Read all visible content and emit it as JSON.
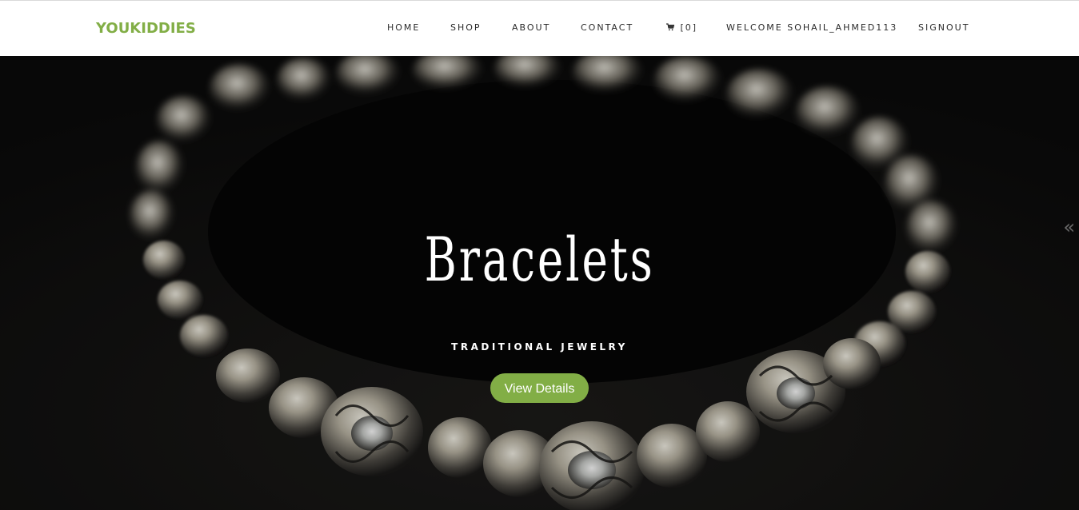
{
  "brand": {
    "name": "YOUKIDDIES",
    "color": "#82ae46"
  },
  "nav": {
    "home": "HOME",
    "shop": "SHOP",
    "about": "ABOUT",
    "contact": "CONTACT",
    "cart_icon": "cart-icon",
    "cart_count": "[0]",
    "welcome": "WELCOME SOHAIL_AHMED113",
    "signout": "SIGNOUT"
  },
  "hero": {
    "title": "Bracelets",
    "subtitle": "TRADITIONAL JEWELRY",
    "button_label": "View Details",
    "button_color": "#82ae46",
    "prev_arrow": "«",
    "image_subject": "bracelet-image"
  }
}
